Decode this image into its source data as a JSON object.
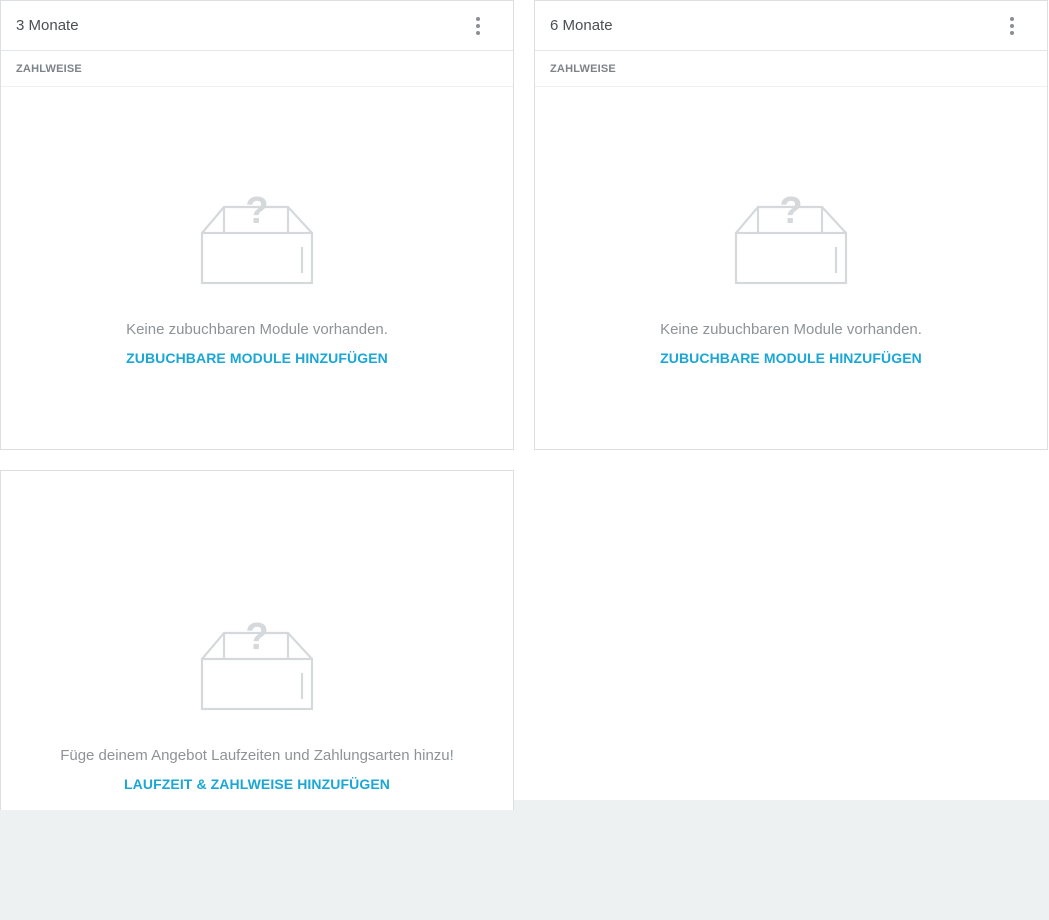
{
  "colors": {
    "accent": "#1aa7d6",
    "border": "#dcdfe1",
    "icon": "#d6d9dc",
    "page_background": "#eef1f1"
  },
  "cards": [
    {
      "title": "3 Monate",
      "section_label": "ZAHLWEISE",
      "empty_text": "Keine zubuchbaren Module vorhanden.",
      "action_label": "ZUBUCHBARE MODULE HINZUFÜGEN",
      "icon": "empty-box-question-icon"
    },
    {
      "title": "6 Monate",
      "section_label": "ZAHLWEISE",
      "empty_text": "Keine zubuchbaren Module vorhanden.",
      "action_label": "ZUBUCHBARE MODULE HINZUFÜGEN",
      "icon": "empty-box-question-icon"
    }
  ],
  "add_card": {
    "empty_text": "Füge deinem Angebot Laufzeiten und Zahlungsarten hinzu!",
    "action_label": "LAUFZEIT & ZAHLWEISE HINZUFÜGEN",
    "icon": "empty-box-question-icon"
  }
}
